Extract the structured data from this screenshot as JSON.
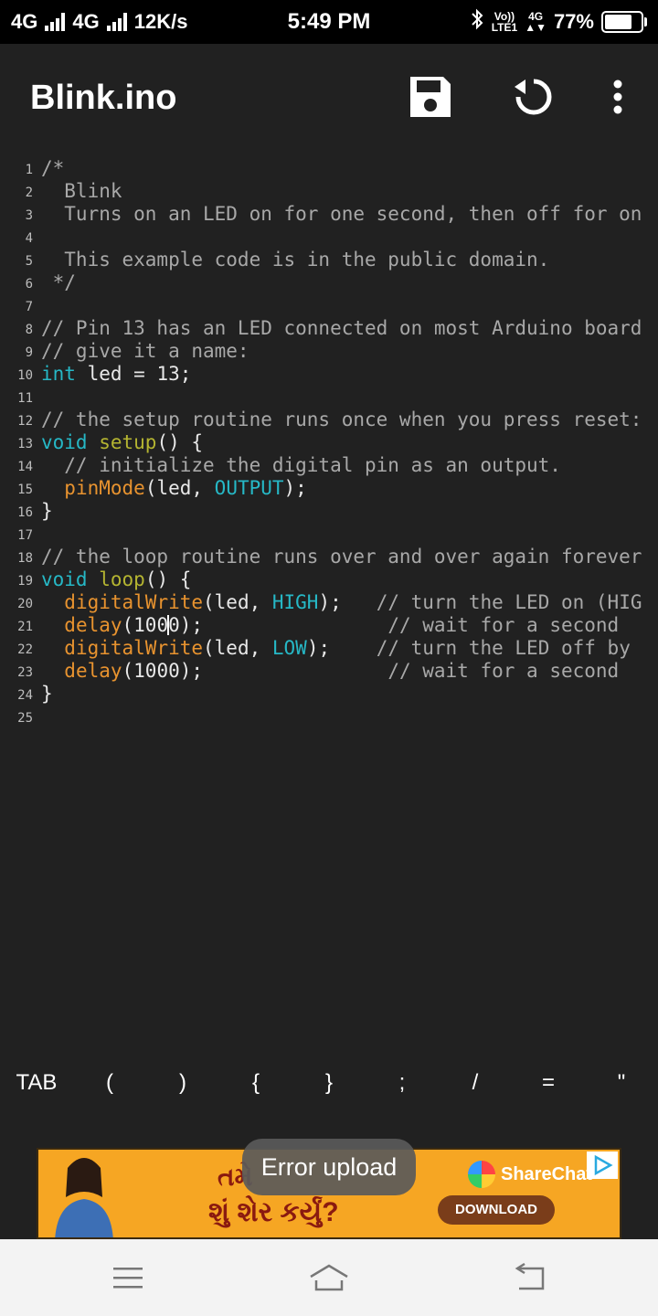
{
  "status_bar": {
    "network1": "4G",
    "network2": "4G",
    "speed": "12K/s",
    "time": "5:49 PM",
    "volte": "Vo))",
    "lte": "LTE1",
    "net_small": "4G",
    "battery": "77%",
    "battery_level": 0.77
  },
  "app_bar": {
    "title": "Blink.ino",
    "save_icon": "save-icon",
    "upload_icon": "refresh-icon",
    "menu_icon": "more-vert-icon"
  },
  "editor": {
    "lines": [
      {
        "num": "1",
        "text": "/*"
      },
      {
        "num": "2",
        "text": "  Blink"
      },
      {
        "num": "3",
        "text": "  Turns on an LED on for one second, then off for on"
      },
      {
        "num": "4",
        "text": ""
      },
      {
        "num": "5",
        "text": "  This example code is in the public domain."
      },
      {
        "num": "6",
        "text": " */"
      },
      {
        "num": "7",
        "text": ""
      },
      {
        "num": "8",
        "text": "// Pin 13 has an LED connected on most Arduino board"
      },
      {
        "num": "9",
        "text": "// give it a name:"
      },
      {
        "num": "10",
        "kw": "int",
        "rest": " led = 13;"
      },
      {
        "num": "11",
        "text": ""
      },
      {
        "num": "12",
        "text": "// the setup routine runs once when you press reset:"
      },
      {
        "num": "13",
        "kw": "void",
        "fn": "setup",
        "rest": "() {"
      },
      {
        "num": "14",
        "text": "  // initialize the digital pin as an output."
      },
      {
        "num": "15",
        "fn": "pinMode",
        "arg": "(led, ",
        "const": "OUTPUT",
        "end": ");"
      },
      {
        "num": "16",
        "text": "}"
      },
      {
        "num": "17",
        "text": ""
      },
      {
        "num": "18",
        "text": "// the loop routine runs over and over again forever"
      },
      {
        "num": "19",
        "kw": "void",
        "fn": "loop",
        "rest": "() {"
      },
      {
        "num": "20",
        "fn": "digitalWrite",
        "arg": "(led, ",
        "const": "HIGH",
        "end": ");",
        "pad": "   ",
        "comment": "// turn the LED on (HIG"
      },
      {
        "num": "21",
        "fn": "delay",
        "arg_a": "(100",
        "arg_b": "0);",
        "pad": "                ",
        "comment": "// wait for a second"
      },
      {
        "num": "22",
        "fn": "digitalWrite",
        "arg": "(led, ",
        "const": "LOW",
        "end": ");",
        "pad": "    ",
        "comment": "// turn the LED off by"
      },
      {
        "num": "23",
        "fn": "delay",
        "arg": "(1000);",
        "pad": "                ",
        "comment": "// wait for a second"
      },
      {
        "num": "24",
        "text": "}"
      },
      {
        "num": "25",
        "text": ""
      }
    ]
  },
  "symbols": [
    "TAB",
    "(",
    ")",
    "{",
    "}",
    ";",
    "/",
    "=",
    "\""
  ],
  "ad": {
    "line1": "તમે ",
    "line2": "શું શેર કર્યું?",
    "brand": "ShareChat",
    "download": "DOWNLOAD"
  },
  "toast": "Error upload",
  "nav": {
    "menu_icon": "recents-icon",
    "home_icon": "home-icon",
    "back_icon": "back-icon"
  }
}
